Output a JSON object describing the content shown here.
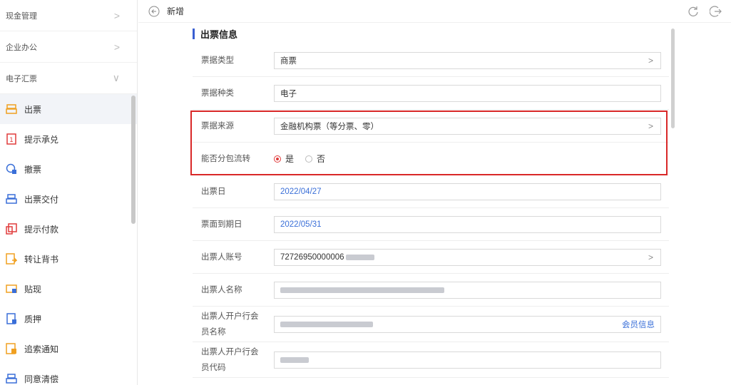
{
  "sidebar": {
    "groups": [
      {
        "label": "现金管理",
        "chevron": ">"
      },
      {
        "label": "企业办公",
        "chevron": ">"
      },
      {
        "label": "电子汇票",
        "chevron": "∨"
      }
    ],
    "items": [
      {
        "label": "出票",
        "icon": "issue-bill-icon",
        "active": true
      },
      {
        "label": "提示承兑",
        "icon": "acceptance-icon"
      },
      {
        "label": "撤票",
        "icon": "revoke-icon"
      },
      {
        "label": "出票交付",
        "icon": "delivery-icon"
      },
      {
        "label": "提示付款",
        "icon": "payment-icon"
      },
      {
        "label": "转让背书",
        "icon": "endorse-icon"
      },
      {
        "label": "贴现",
        "icon": "discount-icon"
      },
      {
        "label": "质押",
        "icon": "pledge-icon"
      },
      {
        "label": "追索通知",
        "icon": "recourse-icon"
      },
      {
        "label": "同意清偿",
        "icon": "settle-icon"
      }
    ],
    "icon_color": "#f0a020"
  },
  "topbar": {
    "title": "新增"
  },
  "section": {
    "title": "出票信息"
  },
  "form": {
    "bill_type": {
      "label": "票据类型",
      "value": "商票",
      "arrow": ">"
    },
    "bill_kind": {
      "label": "票据种类",
      "value": "电子"
    },
    "bill_source": {
      "label": "票据来源",
      "value": "金融机构票（等分票、零）",
      "arrow": ">"
    },
    "split_transfer": {
      "label": "能否分包流转",
      "yes": "是",
      "no": "否",
      "selected": "是"
    },
    "issue_date": {
      "label": "出票日",
      "value": "2022/04/27"
    },
    "due_date": {
      "label": "票面到期日",
      "value": "2022/05/31"
    },
    "drawer_account": {
      "label": "出票人账号",
      "value": "72726950000006",
      "arrow": ">"
    },
    "drawer_name": {
      "label": "出票人名称"
    },
    "drawer_bank_name": {
      "label": "出票人开户行会员名称",
      "link": "会员信息"
    },
    "drawer_bank_code": {
      "label": "出票人开户行会员代码"
    }
  },
  "colors": {
    "accent": "#3a5fd1",
    "highlight": "#d92828",
    "value_blue": "#3a6fd8"
  }
}
